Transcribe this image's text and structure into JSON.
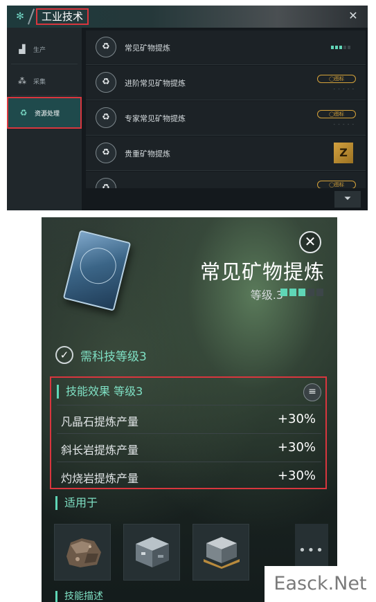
{
  "top_panel": {
    "app_icon": "dna-icon",
    "title": "工业技术",
    "close_icon": "close-icon",
    "sidebar": {
      "items": [
        {
          "label": "生产",
          "icon": "factory-icon",
          "active": false
        },
        {
          "label": "采集",
          "icon": "nodes-icon",
          "active": false
        },
        {
          "label": "资源处理",
          "icon": "recycle-icon",
          "active": true
        }
      ]
    },
    "skills": [
      {
        "label": "常见矿物提炼",
        "state": "level",
        "level": 3,
        "max_level": 5
      },
      {
        "label": "进阶常见矿物提炼",
        "state": "locked",
        "badge": "◯图标"
      },
      {
        "label": "专家常见矿物提炼",
        "state": "locked",
        "badge": "◯图标"
      },
      {
        "label": "贵重矿物提炼",
        "state": "item",
        "tile_letter": "Z"
      },
      {
        "label": "",
        "state": "locked",
        "badge": "◯图标"
      }
    ],
    "empty_pips": "- - - - -",
    "filter_icon": "filter-icon"
  },
  "detail": {
    "title": "常见矿物提炼",
    "level_text": "等级.3",
    "level": 3,
    "max_level": 5,
    "close_icon": "close-icon",
    "requirement": {
      "icon": "check-icon",
      "text": "需科技等级3"
    },
    "effects": {
      "header": "技能效果 等级3",
      "menu_icon": "menu-icon",
      "rows": [
        {
          "name": "凡晶石提炼产量",
          "value": "+30%"
        },
        {
          "name": "斜长岩提炼产量",
          "value": "+30%"
        },
        {
          "name": "灼烧岩提炼产量",
          "value": "+30%"
        }
      ]
    },
    "applies_header": "适用于",
    "ores": [
      {
        "icon": "ore-rock-icon"
      },
      {
        "icon": "ore-cube-icon"
      },
      {
        "icon": "ore-crate-icon"
      }
    ],
    "more_label": "•••",
    "next_header": "技能描述"
  },
  "watermark": "Easck.Net",
  "colors": {
    "accent": "#5fd6b6",
    "highlight_border": "#d9363e",
    "locked": "#d6a33a"
  }
}
